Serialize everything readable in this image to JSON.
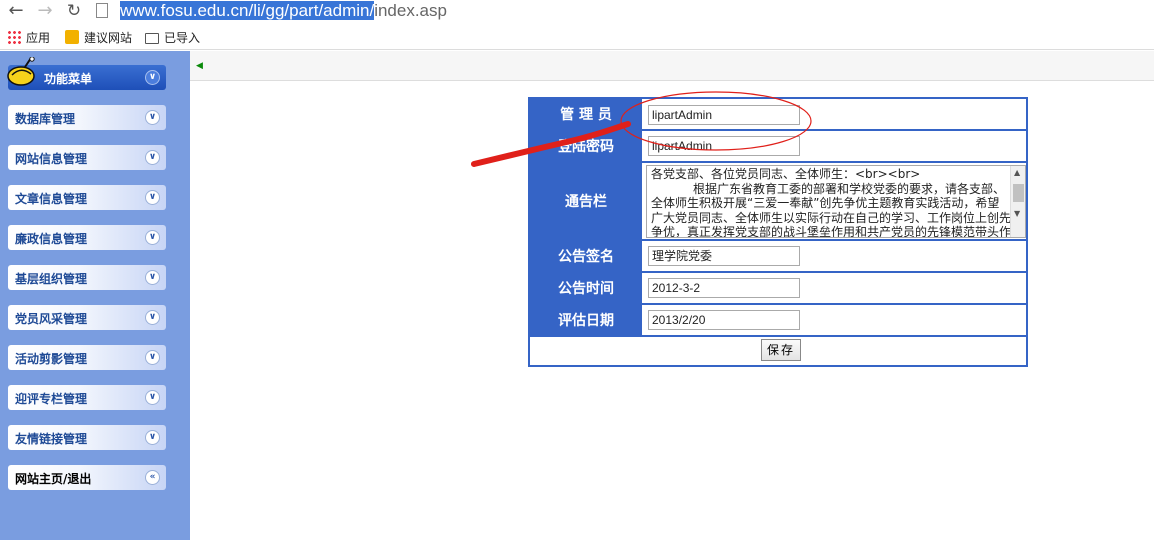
{
  "browser": {
    "url_selected": "www.fosu.edu.cn/li/gg/part/admin/",
    "url_rest": "index.asp",
    "bookmarks": [
      {
        "label": "应用",
        "icon": "apps-grid-icon"
      },
      {
        "label": "建议网站",
        "icon": "bing-icon"
      },
      {
        "label": "已导入",
        "icon": "folder-icon"
      }
    ]
  },
  "sidebar": {
    "header": "功能菜单",
    "items": [
      {
        "label": "数据库管理"
      },
      {
        "label": "网站信息管理"
      },
      {
        "label": "文章信息管理"
      },
      {
        "label": "廉政信息管理"
      },
      {
        "label": "基层组织管理"
      },
      {
        "label": "党员风采管理"
      },
      {
        "label": "活动剪影管理"
      },
      {
        "label": "迎评专栏管理"
      },
      {
        "label": "友情链接管理"
      },
      {
        "label": "网站主页/退出"
      }
    ]
  },
  "form": {
    "admin_label": "管 理 员",
    "admin_value": "lipartAdmin",
    "password_label": "登陆密码",
    "password_value": "lipartAdmin",
    "notice_label": "通告栏",
    "notice_text": "各党支部、各位党员同志、全体师生：<br><br>\n           根据广东省教育工委的部署和学校党委的要求，请各支部、\n全体师生积极开展“三爱一奉献”创先争优主题教育实践活动，希望\n广大党员同志、全体师生以实际行动在自己的学习、工作岗位上创先\n争优，真正发挥党支部的战斗堡垒作用和共产党员的先锋模范带头作",
    "sign_label": "公告签名",
    "sign_value": "理学院党委",
    "time_label": "公告时间",
    "time_value": "2012-3-2",
    "eval_label": "评估日期",
    "eval_value": "2013/2/20",
    "save_label": "保存"
  },
  "colors": {
    "accent": "#3564c6",
    "sidebar_bg": "#7a9de0",
    "annotation": "#e0201a"
  }
}
